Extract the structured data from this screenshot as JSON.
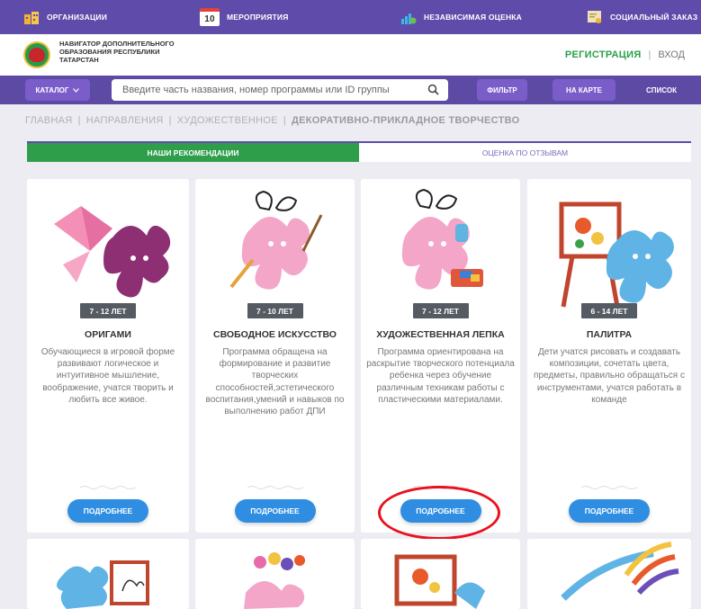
{
  "topbar": {
    "items": [
      {
        "label": "ОРГАНИЗАЦИИ",
        "icon": "buildings-icon"
      },
      {
        "label": "МЕРОПРИЯТИЯ",
        "icon": "calendar-icon",
        "badge": "10"
      },
      {
        "label": "НЕЗАВИСИМАЯ ОЦЕНКА",
        "icon": "bar-chart-icon"
      },
      {
        "label": "СОЦИАЛЬНЫЙ ЗАКАЗ",
        "icon": "certificate-icon"
      }
    ]
  },
  "header": {
    "brand_line1": "НАВИГАТОР ДОПОЛНИТЕЛЬНОГО",
    "brand_line2": "ОБРАЗОВАНИЯ РЕСПУБЛИКИ",
    "brand_line3": "ТАТАРСТАН",
    "register": "РЕГИСТРАЦИЯ",
    "separator": "|",
    "login": "ВХОД"
  },
  "search": {
    "catalog_label": "КАТАЛОГ",
    "placeholder": "Введите часть названия, номер программы или ID группы",
    "filter_label": "ФИЛЬТР",
    "map_label": "НА КАРТЕ",
    "list_label": "СПИСОК"
  },
  "breadcrumb": {
    "items": [
      "ГЛАВНАЯ",
      "НАПРАВЛЕНИЯ",
      "ХУДОЖЕСТВЕННОЕ"
    ],
    "current": "ДЕКОРАТИВНО-ПРИКЛАДНОЕ ТВОРЧЕСТВО",
    "separator": "|"
  },
  "tabs": {
    "recommendations": "НАШИ РЕКОМЕНДАЦИИ",
    "reviews": "ОЦЕНКА ПО ОТЗЫВАМ"
  },
  "cards": [
    {
      "age": "7 - 12 ЛЕТ",
      "title": "ОРИГАМИ",
      "description": "Обучающиеся в игровой форме развивают логическое и интуитивное мышление, воображение, учатся творить и любить все живое.",
      "button": "ПОДРОБНЕЕ"
    },
    {
      "age": "7 - 10 ЛЕТ",
      "title": "СВОБОДНОЕ ИСКУССТВО",
      "description": "Программа обращена на формирование и развитие творческих способностей,эстетического воспитания,умений и навыков по выполнению работ ДПИ",
      "button": "ПОДРОБНЕЕ"
    },
    {
      "age": "7 - 12 ЛЕТ",
      "title": "ХУДОЖЕСТВЕННАЯ ЛЕПКА",
      "description": "Программа ориентирована на раскрытие творческого потенциала ребенка через обучение различным техникам работы с пластическими материалами.",
      "button": "ПОДРОБНЕЕ"
    },
    {
      "age": "6 - 14 ЛЕТ",
      "title": "ПАЛИТРА",
      "description": "Дети учатся рисовать и создавать композиции, сочетать цвета, предметы, правильно обращаться с инструментами, учатся работать в команде",
      "button": "ПОДРОБНЕЕ"
    }
  ],
  "colors": {
    "topbar": "#5f4ba9",
    "accent_green": "#2e9e4b",
    "button_blue": "#2f8ee2",
    "highlight_red": "#e8121d"
  }
}
